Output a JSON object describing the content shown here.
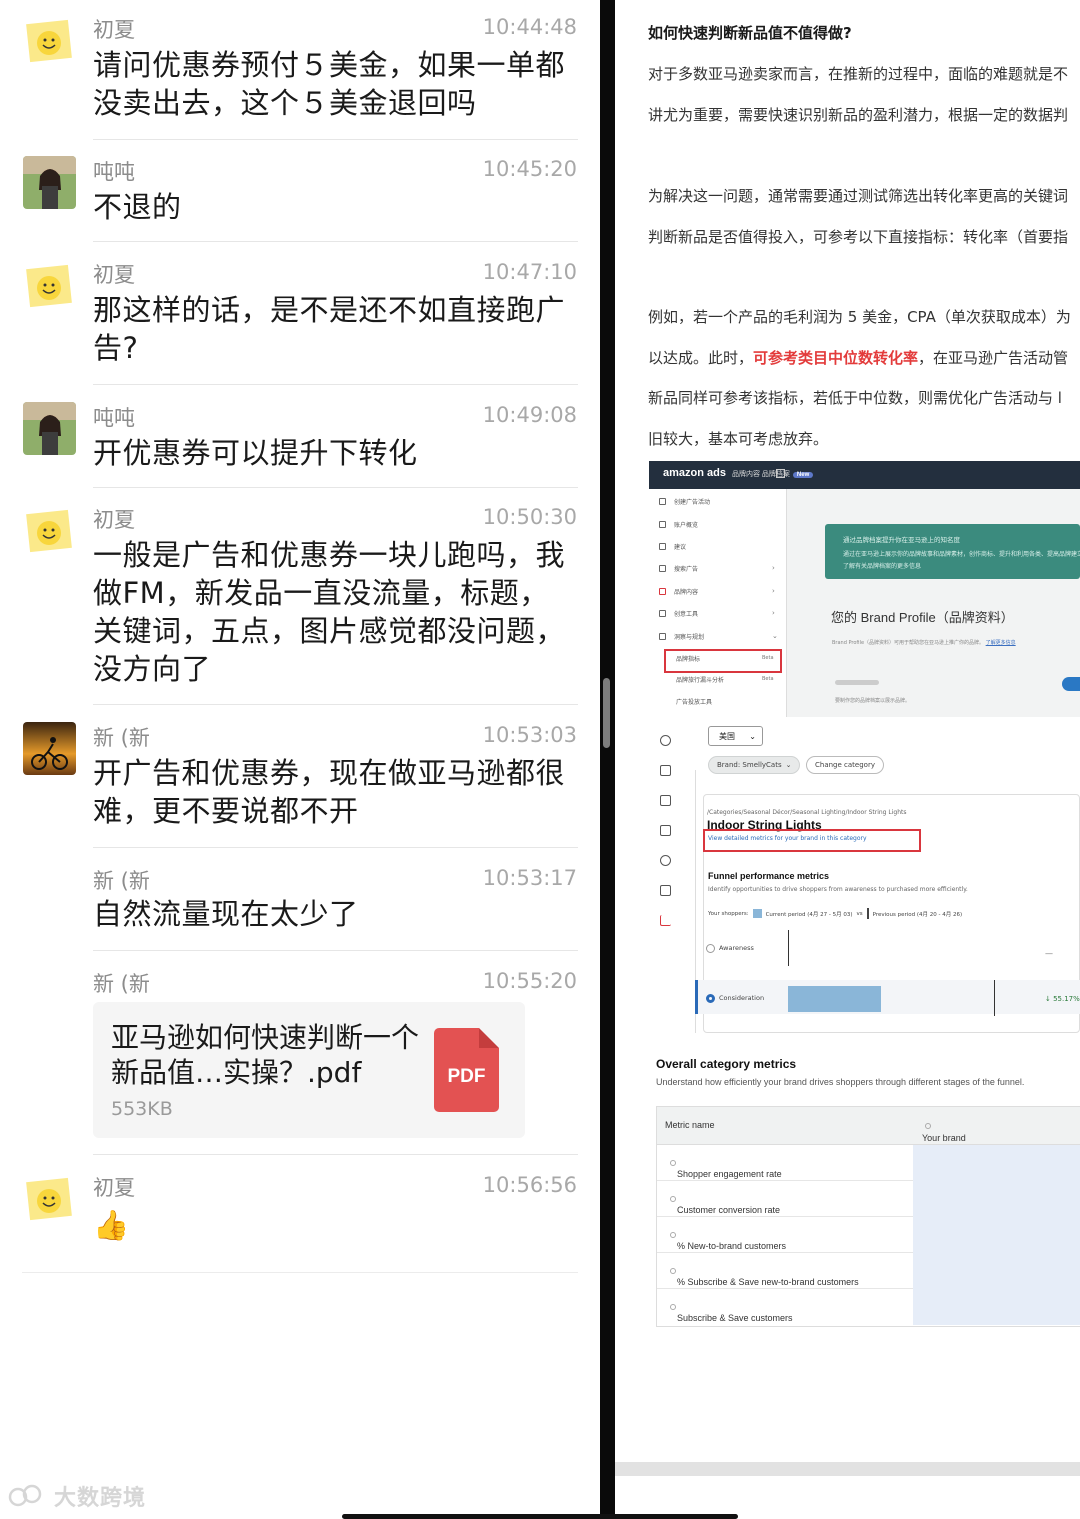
{
  "chat": {
    "messages": [
      {
        "sender": "初夏",
        "time": "10:44:48",
        "text": "请问优惠券预付５美金，如果一单都没卖出去，这个５美金退回吗",
        "avatar": "sticky-note-smiley"
      },
      {
        "sender": "吨吨",
        "time": "10:45:20",
        "text": "不退的",
        "avatar": "girl-photo"
      },
      {
        "sender": "初夏",
        "time": "10:47:10",
        "text": "那这样的话，是不是还不如直接跑广告?",
        "avatar": "sticky-note-smiley"
      },
      {
        "sender": "吨吨",
        "time": "10:49:08",
        "text": "开优惠券可以提升下转化",
        "avatar": "girl-photo"
      },
      {
        "sender": "初夏",
        "time": "10:50:30",
        "text": "一般是广告和优惠券一块儿跑吗，我做FM，新发品一直没流量，标题，关键词，五点，图片感觉都没问题，没方向了",
        "avatar": "sticky-note-smiley"
      },
      {
        "sender": "新 (新",
        "time": "10:53:03",
        "text": "开广告和优惠券，现在做亚马逊都很难，更不要说都不开",
        "avatar": "cyclist-sunset"
      },
      {
        "sender": "新 (新",
        "time": "10:53:17",
        "text": "自然流量现在太少了"
      },
      {
        "sender": "新 (新",
        "time": "10:55:20",
        "file": {
          "name": "亚马逊如何快速判断一个新品值…实操？.pdf",
          "size": "553KB",
          "type": "PDF"
        }
      },
      {
        "sender": "初夏",
        "time": "10:56:56",
        "emoji": "👍",
        "avatar": "sticky-note-smiley"
      }
    ]
  },
  "watermark": "大数跨境",
  "doc": {
    "heading": "如何快速判断新品值不值得做?",
    "lines": [
      "对于多数亚马逊卖家而言，在推新的过程中，面临的难题就是不",
      "讲尤为重要，需要快速识别新品的盈利潜力，根据一定的数据判",
      "为解决这一问题，通常需要通过测试筛选出转化率更高的关键词",
      "判断新品是否值得投入，可参考以下直接指标：转化率（首要指",
      "例如，若一个产品的毛利润为 5 美金，CPA（单次获取成本）为"
    ],
    "line_red_before": "以达成。此时，",
    "line_red": "可参考类目中位数转化率",
    "line_red_after": "，在亚马逊广告活动管",
    "line_after": [
      "新品同样可参考该指标，若低于中位数，则需优化广告活动与 l",
      "旧较大，基本可考虑放弃。"
    ],
    "shot1": {
      "logo": "amazon ads",
      "logo_sub": "品牌内容 品牌档案",
      "new_badge": "New",
      "nav": [
        "创建广告活动",
        "账户概览",
        "建议",
        "搜索广告",
        "品牌内容",
        "创意工具",
        "洞察与规划",
        "品牌指标",
        "品牌旅行漏斗分析",
        "广告投放工具"
      ],
      "nav_badges": {
        "7": "Beta",
        "8": "Beta"
      },
      "banner_lines": [
        "通过品牌档案提升你在亚马逊上的知名度",
        "通过在亚马逊上展示你的品牌故事和品牌素材，创作商标、提升和利用各类、提高品牌建立并增强",
        "了解有关品牌档案的更多信息"
      ],
      "title": "您的 Brand Profile（品牌资料）",
      "subtitle": "Brand Profile（品牌资料）可用于帮助您在亚马逊上推广你的品牌。",
      "subtitle_link": "了解更多信息",
      "note": "要制作您的品牌档案以展示品牌。"
    },
    "shot2": {
      "country": "美国",
      "brand_pill": "Brand: SmellyCats",
      "change_pill": "Change category",
      "breadcrumb": "/Categories/Seasonal Décor/Seasonal Lighting/Indoor String Lights",
      "title": "Indoor String Lights",
      "link": "View detailed metrics for your brand in this category",
      "section_title": "Funnel performance metrics",
      "section_sub": "Identify opportunities to drive shoppers from awareness to purchased more efficiently.",
      "legend_label": "Your shoppers:",
      "legend_current": "Current period (4月 27 - 5月 03)",
      "legend_vs": "vs",
      "legend_previous": "Previous period (4月 20 - 4月 26)",
      "rows": [
        "Awareness",
        "Consideration"
      ],
      "row_dash": "—",
      "row_pct": "↓ 55.17%",
      "consideration_share": 0.37
    },
    "shot3": {
      "title": "Overall category metrics",
      "subtitle": "Understand how efficiently your brand drives shoppers through different stages of the funnel.",
      "col_metric": "Metric name",
      "col_brand": "Your brand",
      "rows": [
        "Shopper engagement rate",
        "Customer conversion rate",
        "% New-to-brand customers",
        "% Subscribe & Save new-to-brand customers",
        "Subscribe & Save customers"
      ]
    }
  },
  "colors": {
    "accent_red": "#e33b3b",
    "amazon_dark": "#232f3e",
    "banner_green": "#3b8b7e",
    "pdf_red": "#e35252"
  }
}
